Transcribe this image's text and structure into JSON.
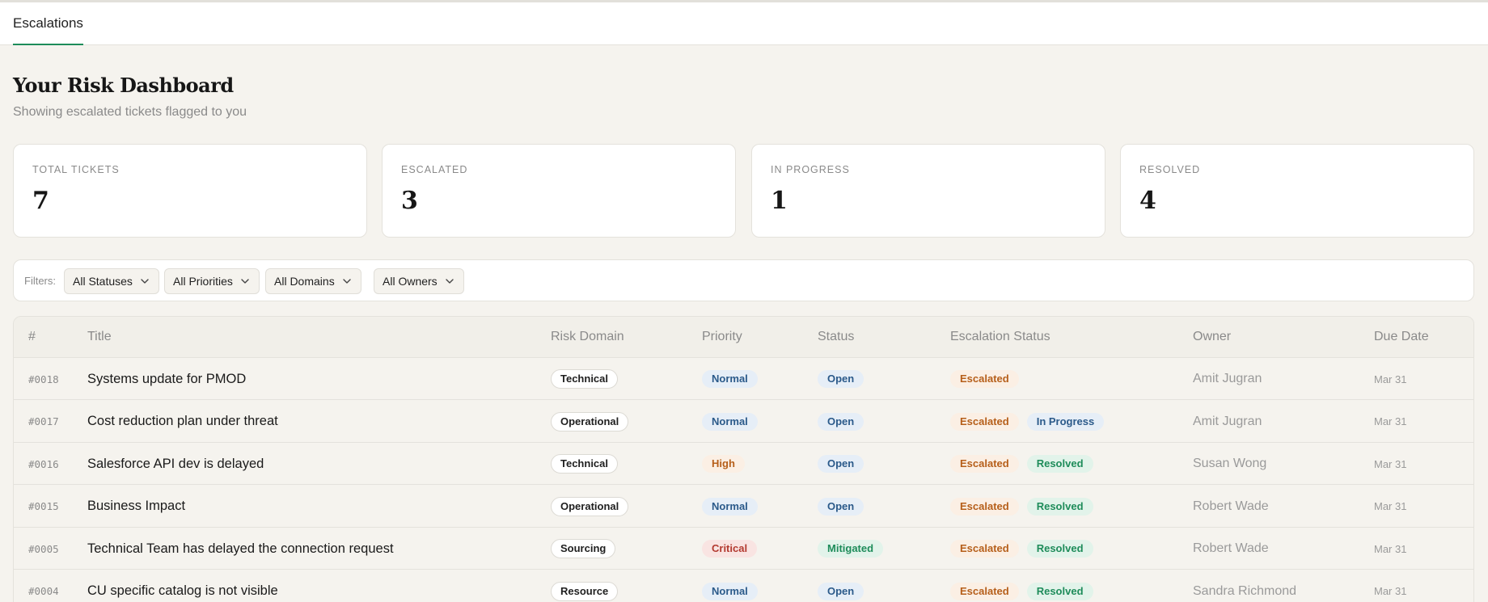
{
  "tabs": [
    {
      "label": "Escalations",
      "active": true
    }
  ],
  "page": {
    "title": "Your Risk Dashboard",
    "subtitle": "Showing escalated tickets flagged to you"
  },
  "stats": [
    {
      "label": "TOTAL TICKETS",
      "value": "7"
    },
    {
      "label": "ESCALATED",
      "value": "3"
    },
    {
      "label": "IN PROGRESS",
      "value": "1"
    },
    {
      "label": "RESOLVED",
      "value": "4"
    }
  ],
  "filters": {
    "label": "Filters:",
    "selects": [
      {
        "value": "All Statuses"
      },
      {
        "value": "All Priorities"
      },
      {
        "value": "All Domains"
      },
      {
        "value": "All Owners"
      }
    ]
  },
  "table": {
    "columns": [
      "#",
      "Title",
      "Risk Domain",
      "Priority",
      "Status",
      "Escalation Status",
      "Owner",
      "Due Date"
    ],
    "rows": [
      {
        "id": "#0018",
        "title": "Systems update for PMOD",
        "domain": "Technical",
        "priority": "Normal",
        "status": "Open",
        "escalation": [
          "Escalated"
        ],
        "owner": "Amit Jugran",
        "due": "Mar 31"
      },
      {
        "id": "#0017",
        "title": "Cost reduction plan under threat",
        "domain": "Operational",
        "priority": "Normal",
        "status": "Open",
        "escalation": [
          "Escalated",
          "In Progress"
        ],
        "owner": "Amit Jugran",
        "due": "Mar 31"
      },
      {
        "id": "#0016",
        "title": "Salesforce API dev is delayed",
        "domain": "Technical",
        "priority": "High",
        "status": "Open",
        "escalation": [
          "Escalated",
          "Resolved"
        ],
        "owner": "Susan Wong",
        "due": "Mar 31"
      },
      {
        "id": "#0015",
        "title": "Business Impact",
        "domain": "Operational",
        "priority": "Normal",
        "status": "Open",
        "escalation": [
          "Escalated",
          "Resolved"
        ],
        "owner": "Robert Wade",
        "due": "Mar 31"
      },
      {
        "id": "#0005",
        "title": "Technical Team has delayed the connection request",
        "domain": "Sourcing",
        "priority": "Critical",
        "status": "Mitigated",
        "escalation": [
          "Escalated",
          "Resolved"
        ],
        "owner": "Robert Wade",
        "due": "Mar 31"
      },
      {
        "id": "#0004",
        "title": "CU specific catalog is not visible",
        "domain": "Resource",
        "priority": "Normal",
        "status": "Open",
        "escalation": [
          "Escalated",
          "Resolved"
        ],
        "owner": "Sandra Richmond",
        "due": "Mar 31"
      }
    ]
  },
  "colors": {
    "accent": "#1e8c5a",
    "background": "#f5f3ee",
    "card": "#ffffff",
    "muted_text": "#8a8a8a",
    "blue_pill_text": "#2b5a8a",
    "orange_pill_text": "#b65f1a",
    "red_pill_text": "#b33a30",
    "green_pill_text": "#1e8c5a"
  },
  "icons": {
    "dropdown": "chevron-down-icon"
  }
}
